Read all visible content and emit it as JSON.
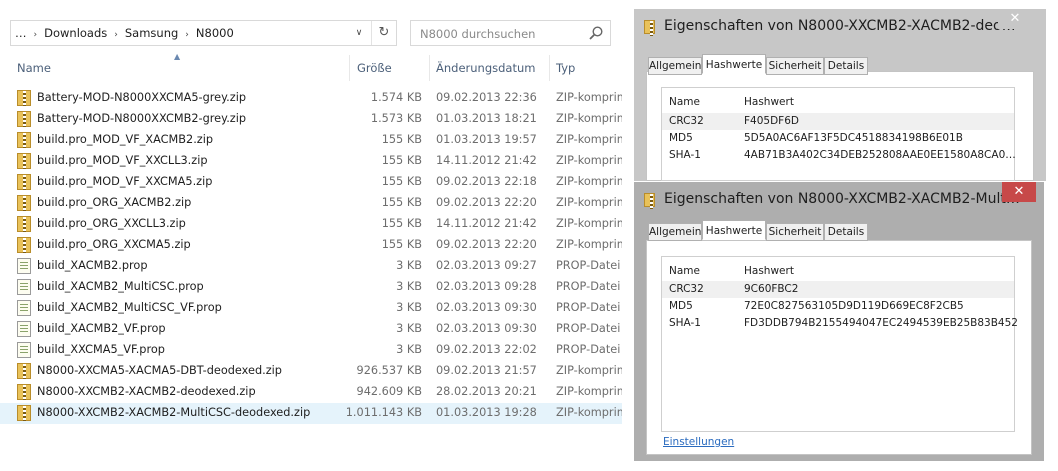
{
  "explorer": {
    "breadcrumb": {
      "items": [
        "…",
        "Downloads",
        "Samsung",
        "N8000"
      ],
      "separator": "›"
    },
    "search_placeholder": "N8000 durchsuchen",
    "columns": {
      "name": "Name",
      "size": "Größe",
      "date": "Änderungsdatum",
      "type": "Typ"
    },
    "files": [
      {
        "name": "Battery-MOD-N8000XXCMA5-grey.zip",
        "size": "1.574 KB",
        "date": "09.02.2013 22:36",
        "type": "ZIP-komprim",
        "icon": "zip-file-icon"
      },
      {
        "name": "Battery-MOD-N8000XXCMB2-grey.zip",
        "size": "1.573 KB",
        "date": "01.03.2013 18:21",
        "type": "ZIP-komprim",
        "icon": "zip-file-icon"
      },
      {
        "name": "build.pro_MOD_VF_XACMB2.zip",
        "size": "155 KB",
        "date": "01.03.2013 19:57",
        "type": "ZIP-komprim",
        "icon": "zip-file-icon"
      },
      {
        "name": "build.pro_MOD_VF_XXCLL3.zip",
        "size": "155 KB",
        "date": "14.11.2012 21:42",
        "type": "ZIP-komprim",
        "icon": "zip-file-icon"
      },
      {
        "name": "build.pro_MOD_VF_XXCMA5.zip",
        "size": "155 KB",
        "date": "09.02.2013 22:18",
        "type": "ZIP-komprim",
        "icon": "zip-file-icon"
      },
      {
        "name": "build.pro_ORG_XACMB2.zip",
        "size": "155 KB",
        "date": "09.02.2013 22:20",
        "type": "ZIP-komprim",
        "icon": "zip-file-icon"
      },
      {
        "name": "build.pro_ORG_XXCLL3.zip",
        "size": "155 KB",
        "date": "14.11.2012 21:42",
        "type": "ZIP-komprim",
        "icon": "zip-file-icon"
      },
      {
        "name": "build.pro_ORG_XXCMA5.zip",
        "size": "155 KB",
        "date": "09.02.2013 22:20",
        "type": "ZIP-komprim",
        "icon": "zip-file-icon"
      },
      {
        "name": "build_XACMB2.prop",
        "size": "3 KB",
        "date": "02.03.2013 09:27",
        "type": "PROP-Datei",
        "icon": "prop-file-icon"
      },
      {
        "name": "build_XACMB2_MultiCSC.prop",
        "size": "3 KB",
        "date": "02.03.2013 09:28",
        "type": "PROP-Datei",
        "icon": "prop-file-icon"
      },
      {
        "name": "build_XACMB2_MultiCSC_VF.prop",
        "size": "3 KB",
        "date": "02.03.2013 09:30",
        "type": "PROP-Datei",
        "icon": "prop-file-icon"
      },
      {
        "name": "build_XACMB2_VF.prop",
        "size": "3 KB",
        "date": "02.03.2013 09:30",
        "type": "PROP-Datei",
        "icon": "prop-file-icon"
      },
      {
        "name": "build_XXCMA5_VF.prop",
        "size": "3 KB",
        "date": "09.02.2013 22:02",
        "type": "PROP-Datei",
        "icon": "prop-file-icon"
      },
      {
        "name": "N8000-XXCMA5-XACMA5-DBT-deodexed.zip",
        "size": "926.537 KB",
        "date": "09.02.2013 21:57",
        "type": "ZIP-komprim",
        "icon": "zip-file-icon"
      },
      {
        "name": "N8000-XXCMB2-XACMB2-deodexed.zip",
        "size": "942.609 KB",
        "date": "28.02.2013 20:21",
        "type": "ZIP-komprim",
        "icon": "zip-file-icon"
      },
      {
        "name": "N8000-XXCMB2-XACMB2-MultiCSC-deodexed.zip",
        "size": "1.011.143 KB",
        "date": "01.03.2013 19:28",
        "type": "ZIP-komprim",
        "icon": "zip-file-icon",
        "selected": true
      }
    ]
  },
  "dialog1": {
    "title": "Eigenschaften von N8000-XXCMB2-XACMB2-deo…",
    "close_glyph": "✕",
    "tabs": [
      "Allgemein",
      "Hashwerte",
      "Sicherheit",
      "Details"
    ],
    "active_tab": "Hashwerte",
    "headers": {
      "name": "Name",
      "value": "Hashwert"
    },
    "hashes": [
      {
        "name": "CRC32",
        "value": "F405DF6D"
      },
      {
        "name": "MD5",
        "value": "5D5A0AC6AF13F5DC4518834198B6E01B"
      },
      {
        "name": "SHA-1",
        "value": "4AB71B3A402C34DEB252808AAE0EE1580A8CA0…"
      }
    ]
  },
  "dialog2": {
    "title": "Eigenschaften von N8000-XXCMB2-XACMB2-Mult…",
    "close_glyph": "✕",
    "tabs": [
      "Allgemein",
      "Hashwerte",
      "Sicherheit",
      "Details"
    ],
    "active_tab": "Hashwerte",
    "headers": {
      "name": "Name",
      "value": "Hashwert"
    },
    "hashes": [
      {
        "name": "CRC32",
        "value": "9C60FBC2"
      },
      {
        "name": "MD5",
        "value": "72E0C827563105D9D119D669EC8F2CB5"
      },
      {
        "name": "SHA-1",
        "value": "FD3DDB794B2155494047EC2494539EB25B83B452"
      }
    ],
    "settings_link": "Einstellungen"
  },
  "colors": {
    "dialog1_frame": "#c7c7c7",
    "dialog1_close": "#c7c7c7",
    "dialog2_frame": "#aeaeae",
    "dialog2_close": "#c74949",
    "selection": "#e5f3fb",
    "link": "#2a6bbf"
  }
}
